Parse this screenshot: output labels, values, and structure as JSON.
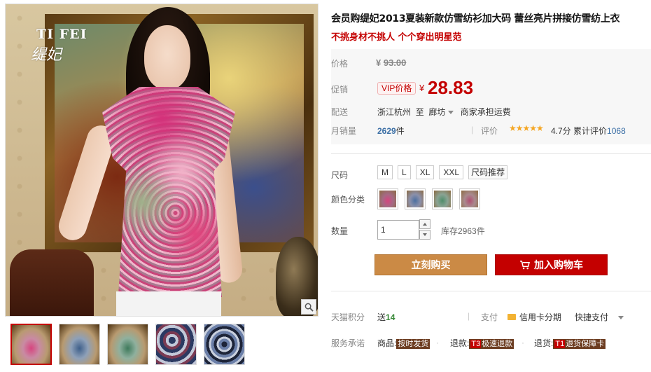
{
  "gallery": {
    "brand_logo": "TI FEI",
    "brand_logo_sub": "缇妃",
    "thumbnails": [
      "thumb-1",
      "thumb-2",
      "thumb-3",
      "thumb-4",
      "thumb-5"
    ]
  },
  "product": {
    "title": "会员购缇妃2013夏装新款仿雪纺衫加大码 蕾丝亮片拼接仿雪纺上衣",
    "subtitle": "不挑身材不挑人 个个穿出明星范"
  },
  "price": {
    "price_label": "价格",
    "currency": "¥",
    "original_price": "93.00",
    "promo_label": "促销",
    "vip_badge": "VIP价格",
    "sale_price": "28.83"
  },
  "delivery": {
    "label": "配送",
    "from": "浙江杭州",
    "to_word": "至",
    "destination": "廊坊",
    "shipping_note": "商家承担运费"
  },
  "sales": {
    "label": "月销量",
    "count": "2629",
    "unit": "件",
    "review_label": "评价",
    "stars": "★★★★★",
    "score": "4.7分",
    "cumulative_label": "累计评价",
    "cumulative_count": "1068"
  },
  "options": {
    "size_label": "尺码",
    "sizes": [
      "M",
      "L",
      "XL",
      "XXL"
    ],
    "size_recommend": "尺码推荐",
    "color_label": "颜色分类",
    "quantity_label": "数量",
    "quantity_value": "1",
    "stock": "库存2963件"
  },
  "actions": {
    "buy_now": "立刻购买",
    "add_to_cart": "加入购物车"
  },
  "extras": {
    "points_label": "天猫积分",
    "points_prefix": "送",
    "points_value": "14",
    "payment_label": "支付",
    "credit_card": "信用卡分期",
    "quick_pay": "快捷支付",
    "service_label": "服务承诺",
    "service_items": [
      {
        "prefix": "商品:",
        "tag": "按时发货",
        "code": ""
      },
      {
        "prefix": "退款:",
        "tag": "极速退款",
        "code": "T3"
      },
      {
        "prefix": "退货:",
        "tag": "退货保障卡",
        "code": "T1"
      }
    ]
  },
  "colors": {
    "accent_red": "#c40000",
    "buy_orange": "#cb8a45",
    "star_yellow": "#f5a623",
    "link_blue": "#3a6ea5"
  }
}
